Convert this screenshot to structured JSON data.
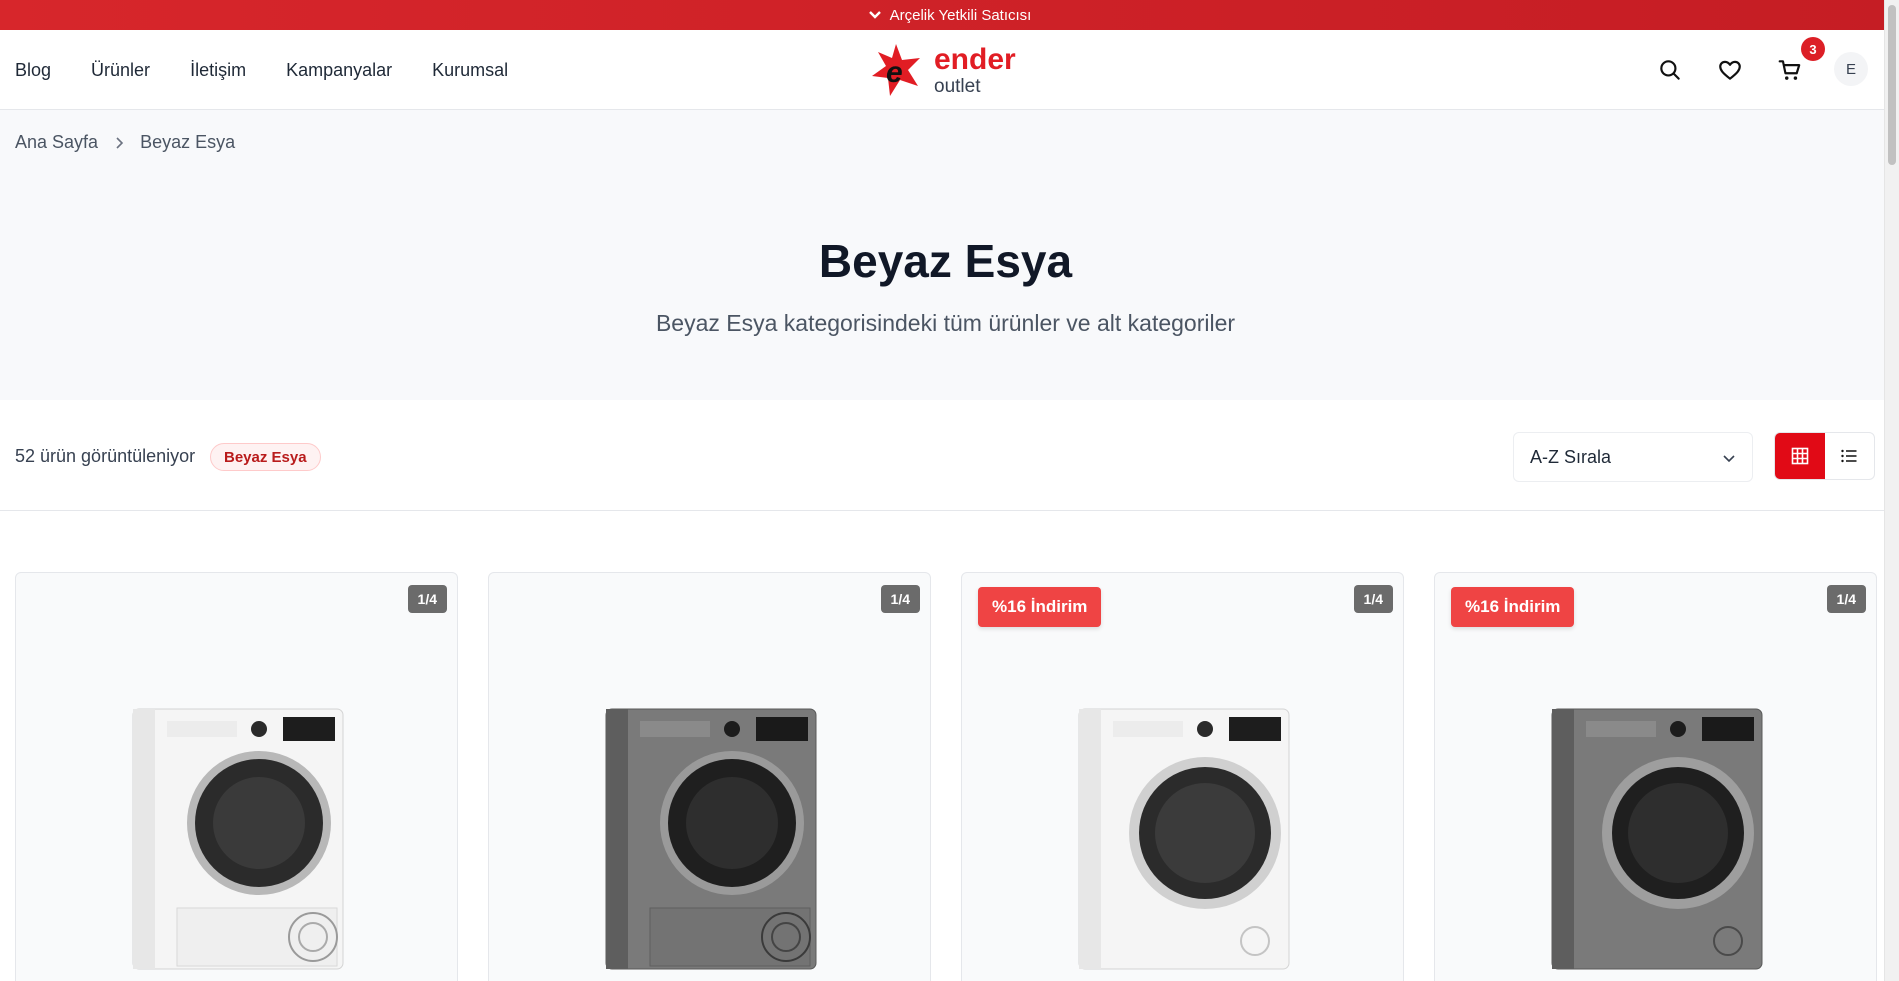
{
  "topbar": {
    "text": "Arçelik Yetkili Satıcısı"
  },
  "header": {
    "nav": [
      "Blog",
      "Ürünler",
      "İletişim",
      "Kampanyalar",
      "Kurumsal"
    ],
    "logo": {
      "line1": "ender",
      "line2": "outlet"
    },
    "cart_count": "3",
    "avatar_initial": "E"
  },
  "breadcrumb": {
    "home": "Ana Sayfa",
    "current": "Beyaz Esya"
  },
  "hero": {
    "title": "Beyaz Esya",
    "subtitle": "Beyaz Esya kategorisindeki tüm ürünler ve alt kategoriler"
  },
  "toolbar": {
    "count_text": "52 ürün görüntüleniyor",
    "filter_chip": "Beyaz Esya",
    "sort_label": "A-Z Sırala"
  },
  "products": [
    {
      "counter": "1/4",
      "badge": "",
      "color": "white",
      "type": "dryer"
    },
    {
      "counter": "1/4",
      "badge": "",
      "color": "grey",
      "type": "dryer"
    },
    {
      "counter": "1/4",
      "badge": "%16 İndirim",
      "color": "white",
      "type": "washer"
    },
    {
      "counter": "1/4",
      "badge": "%16 İndirim",
      "color": "grey",
      "type": "washer"
    }
  ],
  "colors": {
    "brand_red": "#dc1f26",
    "badge_red": "#ef4444",
    "active_view": "#e10a16"
  }
}
